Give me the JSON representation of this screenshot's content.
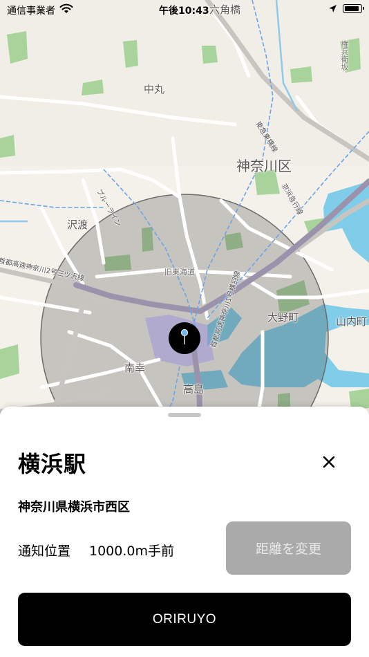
{
  "status_bar": {
    "carrier": "通信事業者",
    "time": "午後10:43"
  },
  "map": {
    "labels": {
      "rokkakubashi": "六角橋",
      "nakamaru": "中丸",
      "kanagawa_ku": "神奈川区",
      "sawatari": "沢渡",
      "kyu_tokaido": "旧東海道",
      "onomachi": "大野町",
      "yamauchicho": "山内町",
      "minamisaiwai": "南幸",
      "takashima": "高島",
      "gongen_zaka": "権兵衛坂",
      "blue_line": "ブルーライン",
      "shuto_mitsuzawa": "首都高速神奈川2号三ツ沢線",
      "tokyu_toyoko": "東急東横線",
      "keihin_kyuko": "京浜急行線",
      "shuto_yokohane": "首都高速神奈川1号横羽線"
    },
    "colors": {
      "land": "#f4f1ea",
      "water": "#7fcde8",
      "park": "#a8d39a",
      "highway": "#9b93ab",
      "radius_fill": "rgba(80,80,80,0.28)"
    }
  },
  "sheet": {
    "station_name": "横浜駅",
    "address": "神奈川県横浜市西区",
    "notify_label": "通知位置",
    "notify_value": "1000.0m手前",
    "change_button": "距離を変更",
    "primary_button": "ORIRUYO"
  },
  "icons": {
    "wifi": "wifi-icon",
    "location": "location-arrow-icon",
    "battery": "battery-icon",
    "pin": "map-pin-icon",
    "close": "close-icon"
  }
}
